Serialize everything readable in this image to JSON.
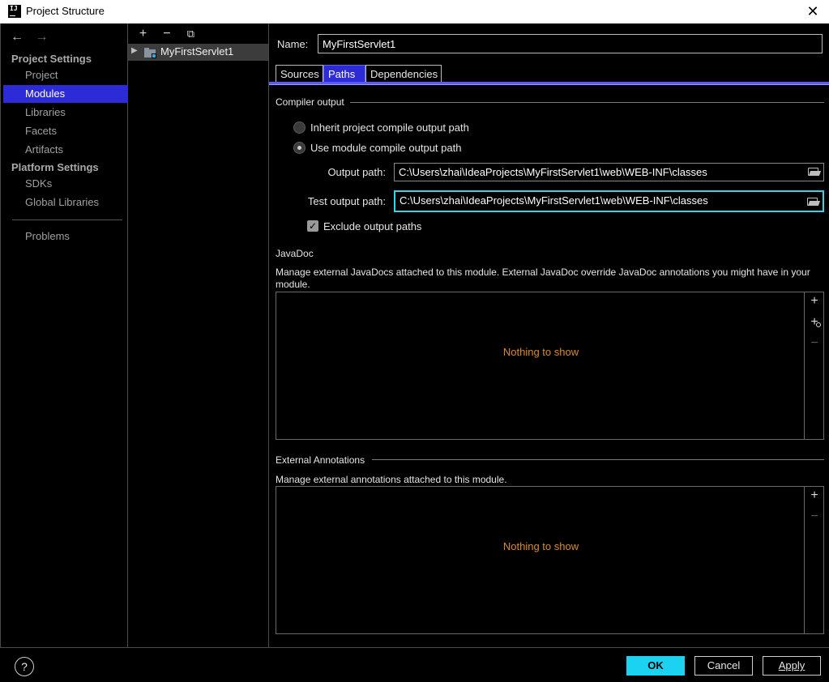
{
  "window": {
    "title": "Project Structure",
    "logo_text": "IJ",
    "close_glyph": "✕"
  },
  "nav": {
    "back_glyph": "←",
    "forward_glyph": "→",
    "project_settings_header": "Project Settings",
    "project_settings_items": [
      "Project",
      "Modules",
      "Libraries",
      "Facets",
      "Artifacts"
    ],
    "platform_settings_header": "Platform Settings",
    "platform_settings_items": [
      "SDKs",
      "Global Libraries"
    ],
    "problems": "Problems",
    "selected": "Modules"
  },
  "tree": {
    "toolbar": {
      "add": "+",
      "remove": "−",
      "copy": "⧉"
    },
    "modules": [
      {
        "name": "MyFirstServlet1",
        "expanded": false
      }
    ]
  },
  "module": {
    "name_label": "Name:",
    "name_value": "MyFirstServlet1",
    "tabs": [
      "Sources",
      "Paths",
      "Dependencies"
    ],
    "active_tab": "Paths",
    "compiler_output": {
      "title": "Compiler output",
      "inherit_label": "Inherit project compile output path",
      "use_module_label": "Use module compile output path",
      "selected_option": "use_module",
      "output_path_label": "Output path:",
      "output_path_value": "C:\\Users\\zhai\\IdeaProjects\\MyFirstServlet1\\web\\WEB-INF\\classes",
      "test_output_path_label": "Test output path:",
      "test_output_path_value": "C:\\Users\\zhai\\IdeaProjects\\MyFirstServlet1\\web\\WEB-INF\\classes",
      "exclude_label": "Exclude output paths",
      "exclude_checked": true,
      "check_glyph": "✓"
    },
    "javadoc": {
      "title": "JavaDoc",
      "description": "Manage external JavaDocs attached to this module. External JavaDoc override JavaDoc annotations you might have in your module.",
      "empty_text": "Nothing to show",
      "tools": {
        "add": "+",
        "add_url": "+",
        "remove": "−"
      }
    },
    "external_annotations": {
      "title": "External Annotations",
      "description": "Manage external annotations attached to this module.",
      "empty_text": "Nothing to show",
      "tools": {
        "add": "+",
        "remove": "−"
      }
    }
  },
  "footer": {
    "help": "?",
    "ok": "OK",
    "cancel": "Cancel",
    "apply": "Apply"
  },
  "colors": {
    "selection": "#2d2bd6",
    "focus_border": "#3ad2e8",
    "primary_button": "#1bd2f0",
    "empty_text": "#d98b2b"
  }
}
